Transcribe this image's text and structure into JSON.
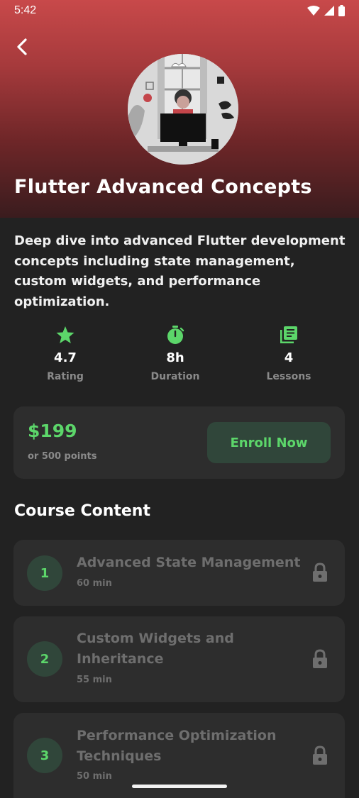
{
  "status_bar": {
    "time": "5:42"
  },
  "course": {
    "title": "Flutter Advanced Concepts",
    "description": "Deep dive into advanced Flutter development concepts including state management, custom widgets, and performance optimization."
  },
  "stats": [
    {
      "icon": "star-icon",
      "value": "4.7",
      "label": "Rating"
    },
    {
      "icon": "timer-icon",
      "value": "8h",
      "label": "Duration"
    },
    {
      "icon": "library-books-icon",
      "value": "4",
      "label": "Lessons"
    }
  ],
  "pricing": {
    "price": "$199",
    "points": "or 500 points",
    "enroll_label": "Enroll Now"
  },
  "content": {
    "section_title": "Course Content",
    "lessons": [
      {
        "number": "1",
        "title": "Advanced State Management",
        "duration": "60 min",
        "locked": true
      },
      {
        "number": "2",
        "title": "Custom Widgets and Inheritance",
        "duration": "55 min",
        "locked": true
      },
      {
        "number": "3",
        "title": "Performance Optimization Techniques",
        "duration": "50 min",
        "locked": true
      }
    ]
  },
  "colors": {
    "accent": "#5cd66a",
    "hero_top": "#c8494a",
    "background": "#222222",
    "card": "#2d2d2d"
  }
}
